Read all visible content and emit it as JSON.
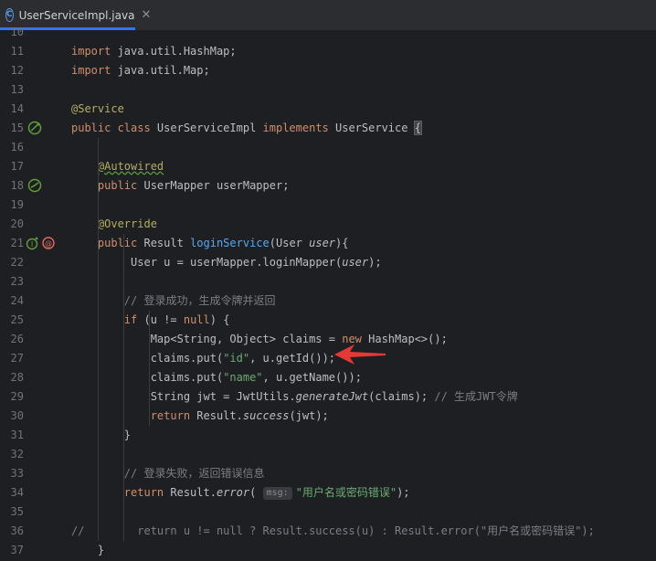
{
  "tab": {
    "title": "UserServiceImpl.java",
    "icon_letter": "C",
    "close": "✕"
  },
  "lines": [
    {
      "num": "10",
      "code": []
    },
    {
      "num": "11",
      "code": [
        [
          "kw",
          "import "
        ],
        [
          "t",
          "java.util.HashMap;"
        ]
      ]
    },
    {
      "num": "12",
      "code": [
        [
          "kw",
          "import "
        ],
        [
          "t",
          "java.util.Map;"
        ]
      ]
    },
    {
      "num": "13",
      "code": []
    },
    {
      "num": "14",
      "code": [
        [
          "ann",
          "@Service"
        ]
      ]
    },
    {
      "num": "15",
      "code": [
        [
          "kw",
          "public class "
        ],
        [
          "t",
          "UserServiceImpl "
        ],
        [
          "kw",
          "implements "
        ],
        [
          "t",
          "UserService "
        ],
        [
          "brace",
          "{"
        ]
      ]
    },
    {
      "num": "16",
      "code": []
    },
    {
      "num": "17",
      "code": [
        [
          "t",
          "    "
        ],
        [
          "annw",
          "@Autowired"
        ]
      ]
    },
    {
      "num": "18",
      "code": [
        [
          "t",
          "    "
        ],
        [
          "kw",
          "public "
        ],
        [
          "t",
          "UserMapper userMapper;"
        ]
      ]
    },
    {
      "num": "19",
      "code": []
    },
    {
      "num": "20",
      "code": [
        [
          "t",
          "    "
        ],
        [
          "ann",
          "@Override"
        ]
      ]
    },
    {
      "num": "21",
      "code": [
        [
          "t",
          "    "
        ],
        [
          "kw",
          "public "
        ],
        [
          "t",
          "Result "
        ],
        [
          "fn",
          "loginService"
        ],
        [
          "t",
          "(User "
        ],
        [
          "param",
          "user"
        ],
        [
          "t",
          ")"
        ],
        [
          "t",
          "{"
        ]
      ]
    },
    {
      "num": "22",
      "code": [
        [
          "t",
          "         User u = userMapper."
        ],
        [
          "t",
          "loginMapper("
        ],
        [
          "param",
          "user"
        ],
        [
          "t",
          ");"
        ]
      ]
    },
    {
      "num": "23",
      "code": []
    },
    {
      "num": "24",
      "code": [
        [
          "t",
          "        "
        ],
        [
          "comment",
          "// 登录成功，生成令牌并返回"
        ]
      ]
    },
    {
      "num": "25",
      "code": [
        [
          "t",
          "        "
        ],
        [
          "kw",
          "if "
        ],
        [
          "t",
          "(u != "
        ],
        [
          "kw",
          "null"
        ],
        [
          "t",
          ") {"
        ]
      ]
    },
    {
      "num": "26",
      "code": [
        [
          "t",
          "            Map<String, Object> claims = "
        ],
        [
          "kw",
          "new "
        ],
        [
          "t",
          "HashMap<>();"
        ]
      ]
    },
    {
      "num": "27",
      "code": [
        [
          "t",
          "            claims."
        ],
        [
          "t",
          "put("
        ],
        [
          "str",
          "\"id\""
        ],
        [
          "t",
          ", u."
        ],
        [
          "t",
          "getId());"
        ]
      ]
    },
    {
      "num": "28",
      "code": [
        [
          "t",
          "            claims."
        ],
        [
          "t",
          "put("
        ],
        [
          "str",
          "\"name\""
        ],
        [
          "t",
          ", u."
        ],
        [
          "t",
          "getName());"
        ]
      ]
    },
    {
      "num": "29",
      "code": [
        [
          "t",
          "            String jwt = JwtUtils."
        ],
        [
          "static",
          "generateJwt"
        ],
        [
          "t",
          "(claims); "
        ],
        [
          "comment",
          "// 生成JWT令牌"
        ]
      ]
    },
    {
      "num": "30",
      "code": [
        [
          "t",
          "            "
        ],
        [
          "kw",
          "return "
        ],
        [
          "t",
          "Result."
        ],
        [
          "static",
          "success"
        ],
        [
          "t",
          "(jwt);"
        ]
      ]
    },
    {
      "num": "31",
      "code": [
        [
          "t",
          "        }"
        ]
      ]
    },
    {
      "num": "32",
      "code": []
    },
    {
      "num": "33",
      "code": [
        [
          "t",
          "        "
        ],
        [
          "comment",
          "// 登录失败，返回错误信息"
        ]
      ]
    },
    {
      "num": "34",
      "code": [
        [
          "t",
          "        "
        ],
        [
          "kw",
          "return "
        ],
        [
          "t",
          "Result."
        ],
        [
          "static",
          "error"
        ],
        [
          "t",
          "( "
        ],
        [
          "hint",
          "msg:"
        ],
        [
          "str",
          "\"用户名或密码错误\""
        ],
        [
          "t",
          ");"
        ]
      ]
    },
    {
      "num": "35",
      "code": []
    },
    {
      "num": "36",
      "code": [
        [
          "comment",
          "//        return u != null ? Result.success(u) : Result.error(\"用户名或密码错误\");"
        ]
      ]
    },
    {
      "num": "37",
      "code": [
        [
          "t",
          "    }"
        ]
      ]
    }
  ],
  "gutter_icons": [
    {
      "line": "15",
      "name": "implementation-bean-icon",
      "color": "#5f9e3e"
    },
    {
      "line": "18",
      "name": "autowired-bean-icon",
      "color": "#5f9e3e"
    },
    {
      "line": "21",
      "name": "implements-method-icon",
      "color": "#5f9e3e"
    },
    {
      "line": "21",
      "name": "override-method-icon",
      "color": "#e06c60"
    }
  ],
  "arrow": {
    "name": "red-arrow-annotation",
    "color": "#e53935"
  }
}
